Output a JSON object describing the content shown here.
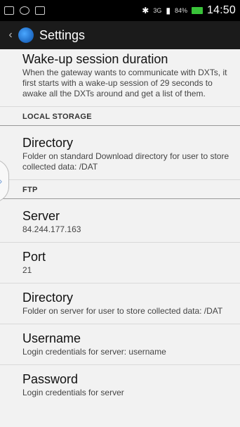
{
  "status": {
    "network": "3G",
    "signal": "84%",
    "time": "14:50"
  },
  "actionbar": {
    "title": "Settings"
  },
  "prefs_top": {
    "wake_title": "Wake-up session duration",
    "wake_summary": "When the gateway wants to communicate with DXTs, it first starts with a wake-up session of 29 seconds to awake all the DXTs around and get a list of them."
  },
  "local_storage": {
    "header": "LOCAL STORAGE",
    "directory_title": "Directory",
    "directory_summary": "Folder on standard Download directory for user to store collected data: /DAT"
  },
  "ftp": {
    "header": "FTP",
    "server_title": "Server",
    "server_value": "84.244.177.163",
    "port_title": "Port",
    "port_value": "21",
    "directory_title": "Directory",
    "directory_summary": "Folder on server for user to store collected data: /DAT",
    "username_title": "Username",
    "username_summary": "Login credentials for server: username",
    "password_title": "Password",
    "password_summary": "Login credentials for server"
  }
}
